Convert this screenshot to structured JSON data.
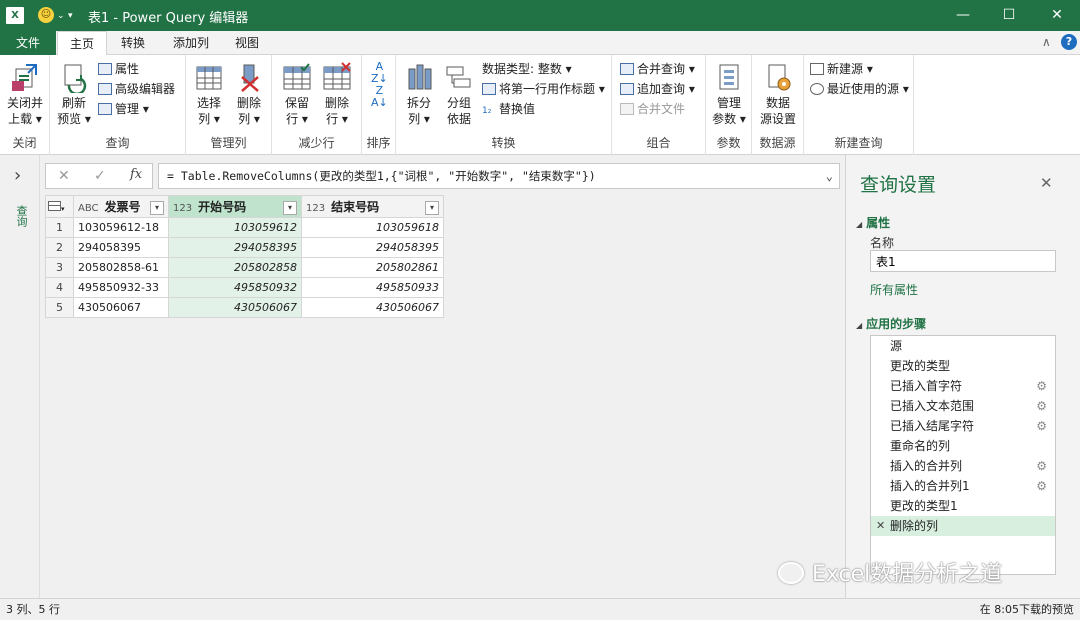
{
  "window": {
    "title": "表1 - Power Query 编辑器",
    "app_logo": "X",
    "minimize": "—",
    "maximize": "☐",
    "close": "✕"
  },
  "tabs": [
    "文件",
    "主页",
    "转换",
    "添加列",
    "视图"
  ],
  "active_tab": "主页",
  "ribbon": {
    "close_group": {
      "label": "关闭",
      "btn1": "关闭并",
      "btn2": "上载 ▾"
    },
    "query_group": {
      "label": "查询",
      "refresh1": "刷新",
      "refresh2": "预览 ▾",
      "properties": "属性",
      "advanced_editor": "高级编辑器",
      "manage": "管理 ▾"
    },
    "manage_cols_group": {
      "label": "管理列",
      "choose1": "选择",
      "choose2": "列 ▾",
      "remove1": "删除",
      "remove2": "列 ▾"
    },
    "reduce_rows_group": {
      "label": "减少行",
      "keep1": "保留",
      "keep2": "行 ▾",
      "delete1": "删除",
      "delete2": "行 ▾"
    },
    "sort_group": {
      "label": "排序"
    },
    "transform_group": {
      "label": "转换",
      "split1": "拆分",
      "split2": "列 ▾",
      "group1": "分组",
      "group2": "依据",
      "datatype": "数据类型: 整数 ▾",
      "first_row": "将第一行用作标题 ▾",
      "replace": "替换值"
    },
    "combine_group": {
      "label": "组合",
      "merge": "合并查询 ▾",
      "append": "追加查询 ▾",
      "combine_files": "合并文件"
    },
    "params_group": {
      "label": "参数",
      "manage1": "管理",
      "manage2": "参数 ▾"
    },
    "datasource_group": {
      "label": "数据源",
      "settings1": "数据",
      "settings2": "源设置"
    },
    "newquery_group": {
      "label": "新建查询",
      "new_source": "新建源 ▾",
      "recent": "最近使用的源 ▾"
    }
  },
  "formula": {
    "text": "= Table.RemoveColumns(更改的类型1,{\"词根\", \"开始数字\", \"结束数字\"})",
    "fx": "fx",
    "cancel": "✕",
    "confirm": "✓"
  },
  "nav_strip": {
    "toggle": "›",
    "label": "查询"
  },
  "table": {
    "columns": [
      {
        "type": "ABC",
        "name": "发票号"
      },
      {
        "type": "123",
        "name": "开始号码"
      },
      {
        "type": "123",
        "name": "结束号码"
      }
    ],
    "rows": [
      [
        "1",
        "103059612-18",
        "103059612",
        "103059618"
      ],
      [
        "2",
        "294058395",
        "294058395",
        "294058395"
      ],
      [
        "3",
        "205802858-61",
        "205802858",
        "205802861"
      ],
      [
        "4",
        "495850932-33",
        "495850932",
        "495850933"
      ],
      [
        "5",
        "430506067",
        "430506067",
        "430506067"
      ]
    ]
  },
  "query_settings": {
    "title": "查询设置",
    "close": "✕",
    "properties_heading": "属性",
    "name_label": "名称",
    "name_value": "表1",
    "all_properties": "所有属性",
    "steps_heading": "应用的步骤",
    "steps": [
      {
        "label": "源",
        "gear": false
      },
      {
        "label": "更改的类型",
        "gear": false
      },
      {
        "label": "已插入首字符",
        "gear": true
      },
      {
        "label": "已插入文本范围",
        "gear": true
      },
      {
        "label": "已插入结尾字符",
        "gear": true
      },
      {
        "label": "重命名的列",
        "gear": false
      },
      {
        "label": "插入的合并列",
        "gear": true
      },
      {
        "label": "插入的合并列1",
        "gear": true
      },
      {
        "label": "更改的类型1",
        "gear": false
      },
      {
        "label": "删除的列",
        "gear": false,
        "selected": true
      }
    ]
  },
  "status": {
    "left": "3 列、5 行",
    "right": "在 8:05下载的预览"
  },
  "watermark": "Excel数据分析之道",
  "colors": {
    "accent": "#217346",
    "selected_col": "#bfe3cc"
  }
}
